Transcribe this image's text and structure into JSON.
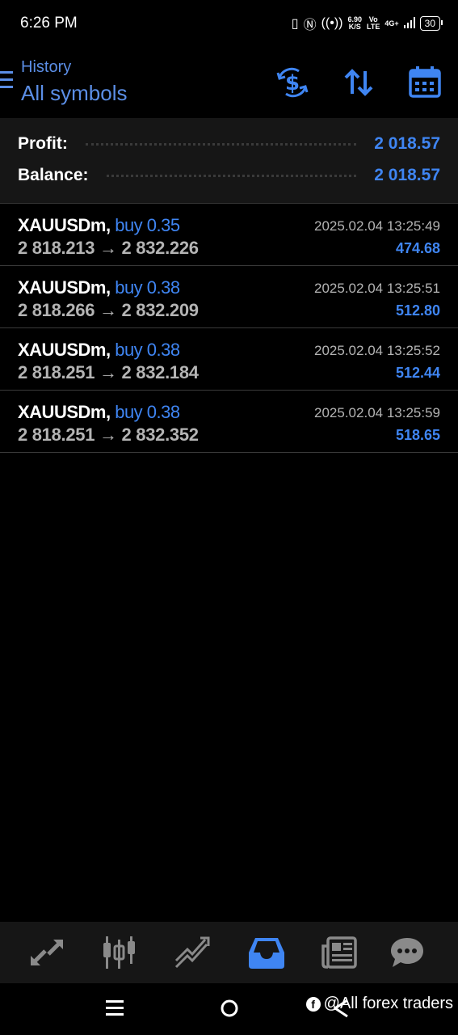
{
  "status_bar": {
    "time": "6:26 PM",
    "net_speed_top": "6.90",
    "net_speed_bottom": "K/S",
    "volte_top": "Vo",
    "volte_bottom": "LTE",
    "network": "4G+",
    "battery": "30"
  },
  "header": {
    "subtitle": "History",
    "title": "All symbols"
  },
  "summary": {
    "profit_label": "Profit:",
    "profit_value": "2 018.57",
    "balance_label": "Balance:",
    "balance_value": "2 018.57"
  },
  "trades": [
    {
      "symbol": "XAUUSDm,",
      "side": "buy 0.35",
      "open": "2 818.213",
      "arrow": "→",
      "close": "2 832.226",
      "time": "2025.02.04 13:25:49",
      "profit": "474.68"
    },
    {
      "symbol": "XAUUSDm,",
      "side": "buy 0.38",
      "open": "2 818.266",
      "arrow": "→",
      "close": "2 832.209",
      "time": "2025.02.04 13:25:51",
      "profit": "512.80"
    },
    {
      "symbol": "XAUUSDm,",
      "side": "buy 0.38",
      "open": "2 818.251",
      "arrow": "→",
      "close": "2 832.184",
      "time": "2025.02.04 13:25:52",
      "profit": "512.44"
    },
    {
      "symbol": "XAUUSDm,",
      "side": "buy 0.38",
      "open": "2 818.251",
      "arrow": "→",
      "close": "2 832.352",
      "time": "2025.02.04 13:25:59",
      "profit": "518.65"
    }
  ],
  "bottom_nav": {
    "items": [
      "quotes-icon",
      "chart-icon",
      "trade-icon",
      "history-icon",
      "news-icon",
      "chat-icon"
    ],
    "active": "history-icon",
    "active_color": "#3f85f2",
    "inactive_color": "#8a8a8a"
  },
  "watermark": {
    "text": "@All forex traders"
  },
  "colors": {
    "accent": "#3f85f2",
    "header_accent": "#5b8ee6",
    "background": "#000000",
    "panel": "#161616"
  }
}
